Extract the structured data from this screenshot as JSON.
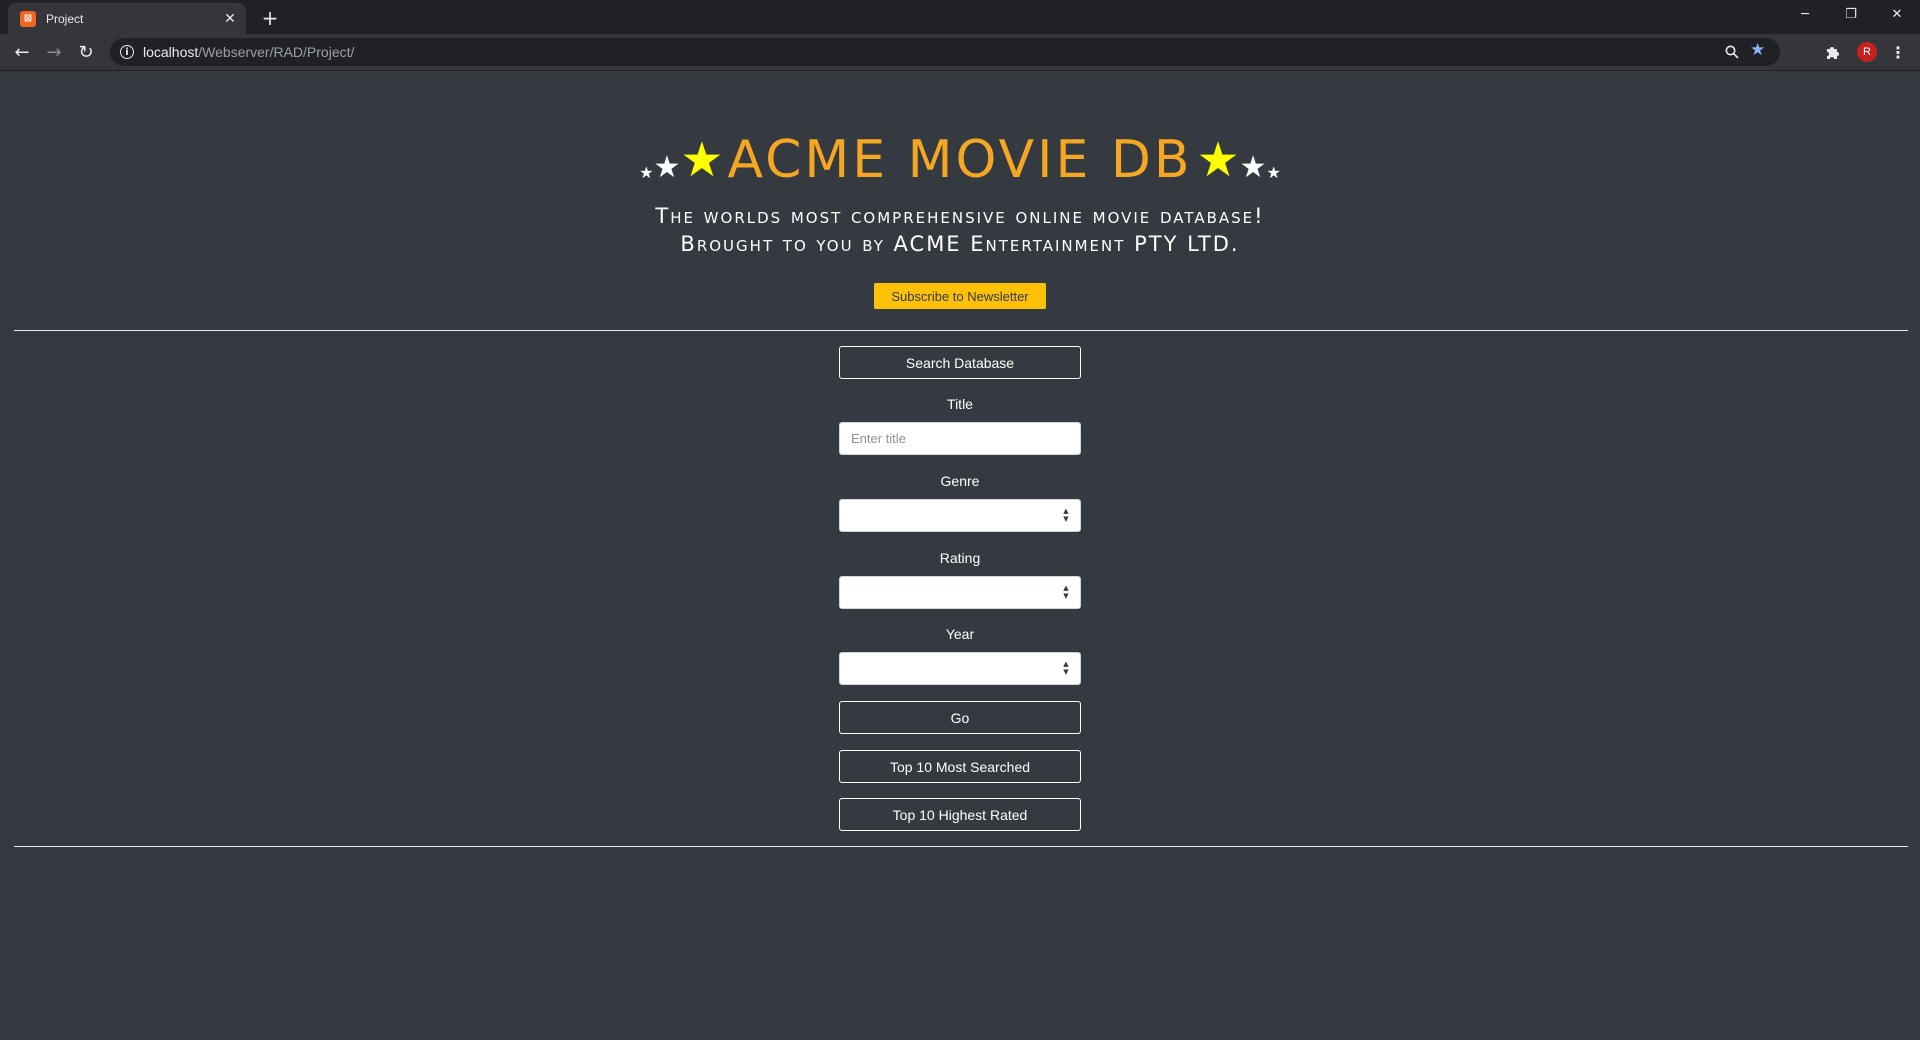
{
  "browser": {
    "tab_title": "Project",
    "favicon_text": "⊠",
    "url_host": "localhost",
    "url_path": "/Webserver/RAD/Project/",
    "profile_initial": "R"
  },
  "header": {
    "title": "ACME MOVIE DB",
    "tagline_line1": "The worlds most comprehensive online movie database!",
    "tagline_line2": "Brought to you by ACME Entertainment PTY LTD.",
    "subscribe_label": "Subscribe to Newsletter"
  },
  "search": {
    "heading_button": "Search Database",
    "title_label": "Title",
    "title_placeholder": "Enter title",
    "title_value": "",
    "genre_label": "Genre",
    "genre_value": "",
    "rating_label": "Rating",
    "rating_value": "",
    "year_label": "Year",
    "year_value": "",
    "go_label": "Go",
    "top_searched_label": "Top 10 Most Searched",
    "top_rated_label": "Top 10 Highest Rated"
  },
  "colors": {
    "background": "#343a40",
    "brand": "#f5a623",
    "star": "#ffff00",
    "subscribe": "#ffc107"
  }
}
